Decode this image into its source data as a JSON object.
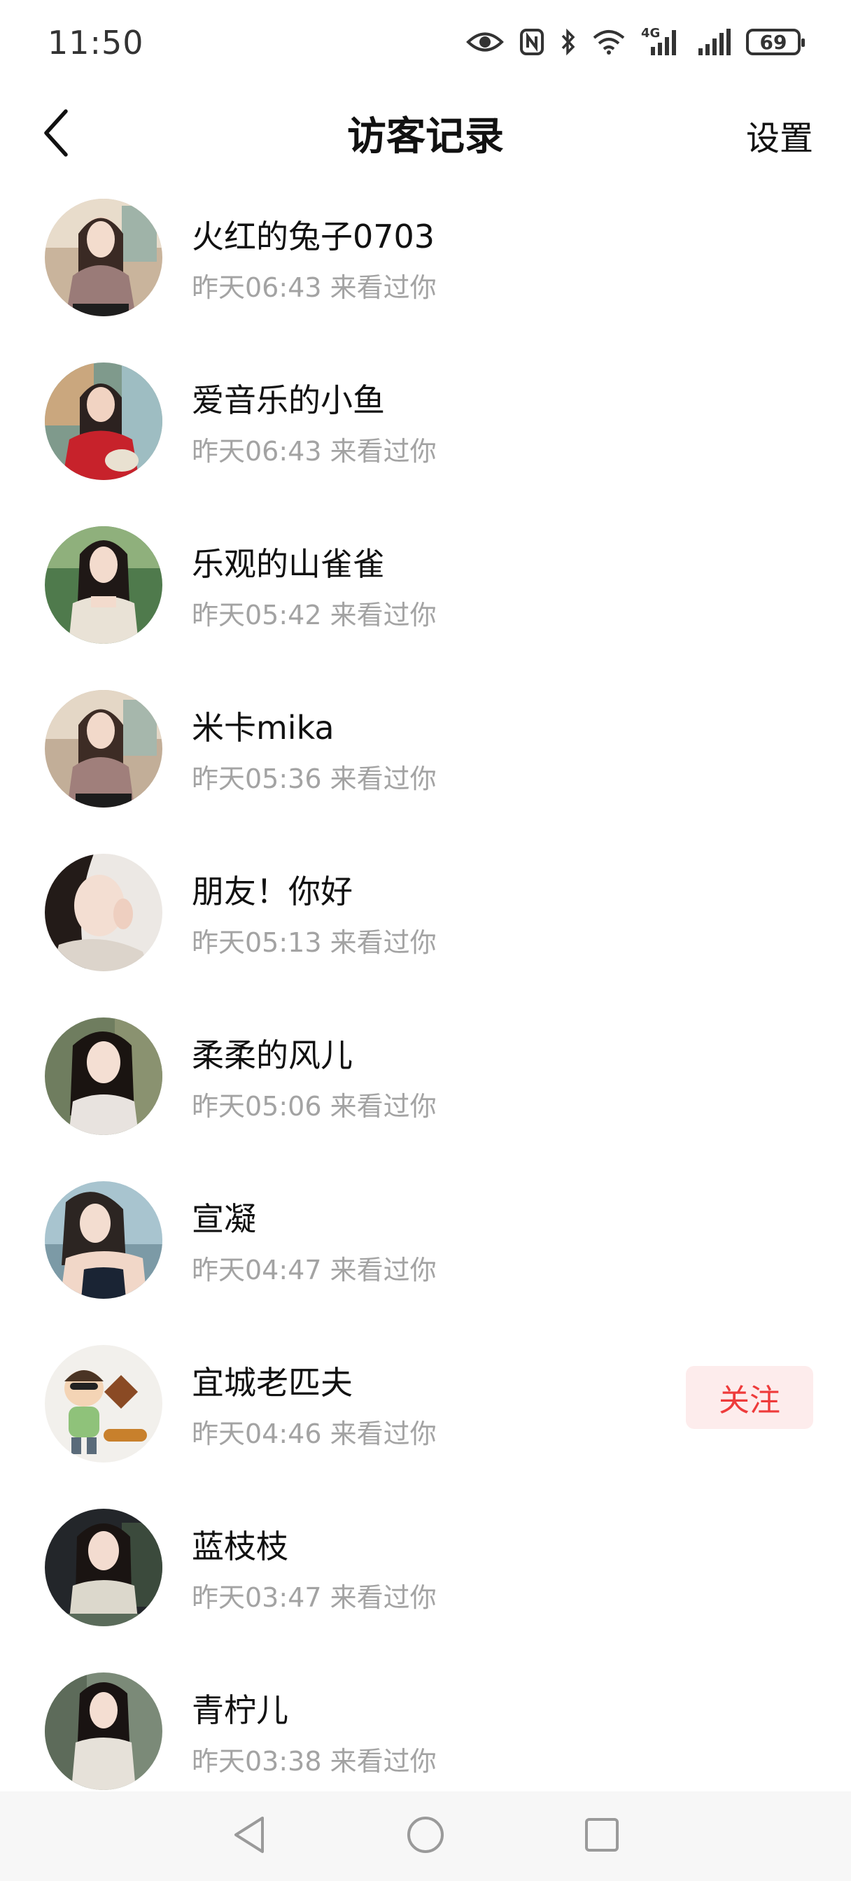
{
  "status_bar": {
    "time": "11:50",
    "network_label": "4G",
    "battery_level": "69",
    "icons": [
      "eye-icon",
      "nfc-icon",
      "bluetooth-icon",
      "wifi-icon",
      "signal-4g-icon",
      "signal-icon",
      "battery-icon"
    ]
  },
  "header": {
    "title": "访客记录",
    "settings_label": "设置",
    "back_icon": "chevron-left-icon"
  },
  "colors": {
    "accent_red": "#ee3b3b",
    "follow_bg": "#fdecec",
    "secondary_text": "#a3a3a3"
  },
  "visitors": [
    {
      "name": "火红的兔子0703",
      "visit_time": "昨天06:43 来看过你"
    },
    {
      "name": "爱音乐的小鱼",
      "visit_time": "昨天06:43 来看过你"
    },
    {
      "name": "乐观的山雀雀",
      "visit_time": "昨天05:42 来看过你"
    },
    {
      "name": "米卡mika",
      "visit_time": "昨天05:36 来看过你"
    },
    {
      "name": "朋友！你好",
      "visit_time": "昨天05:13 来看过你"
    },
    {
      "name": "柔柔的风儿",
      "visit_time": "昨天05:06 来看过你"
    },
    {
      "name": "宣凝",
      "visit_time": "昨天04:47 来看过你"
    },
    {
      "name": "宜城老匹夫",
      "visit_time": "昨天04:46 来看过你",
      "follow_label": "关注"
    },
    {
      "name": "蓝枝枝",
      "visit_time": "昨天03:47 来看过你"
    },
    {
      "name": "青柠儿",
      "visit_time": "昨天03:38 来看过你"
    }
  ],
  "nav_bar": {
    "icons": [
      "back-triangle-icon",
      "home-circle-icon",
      "recents-square-icon"
    ]
  }
}
